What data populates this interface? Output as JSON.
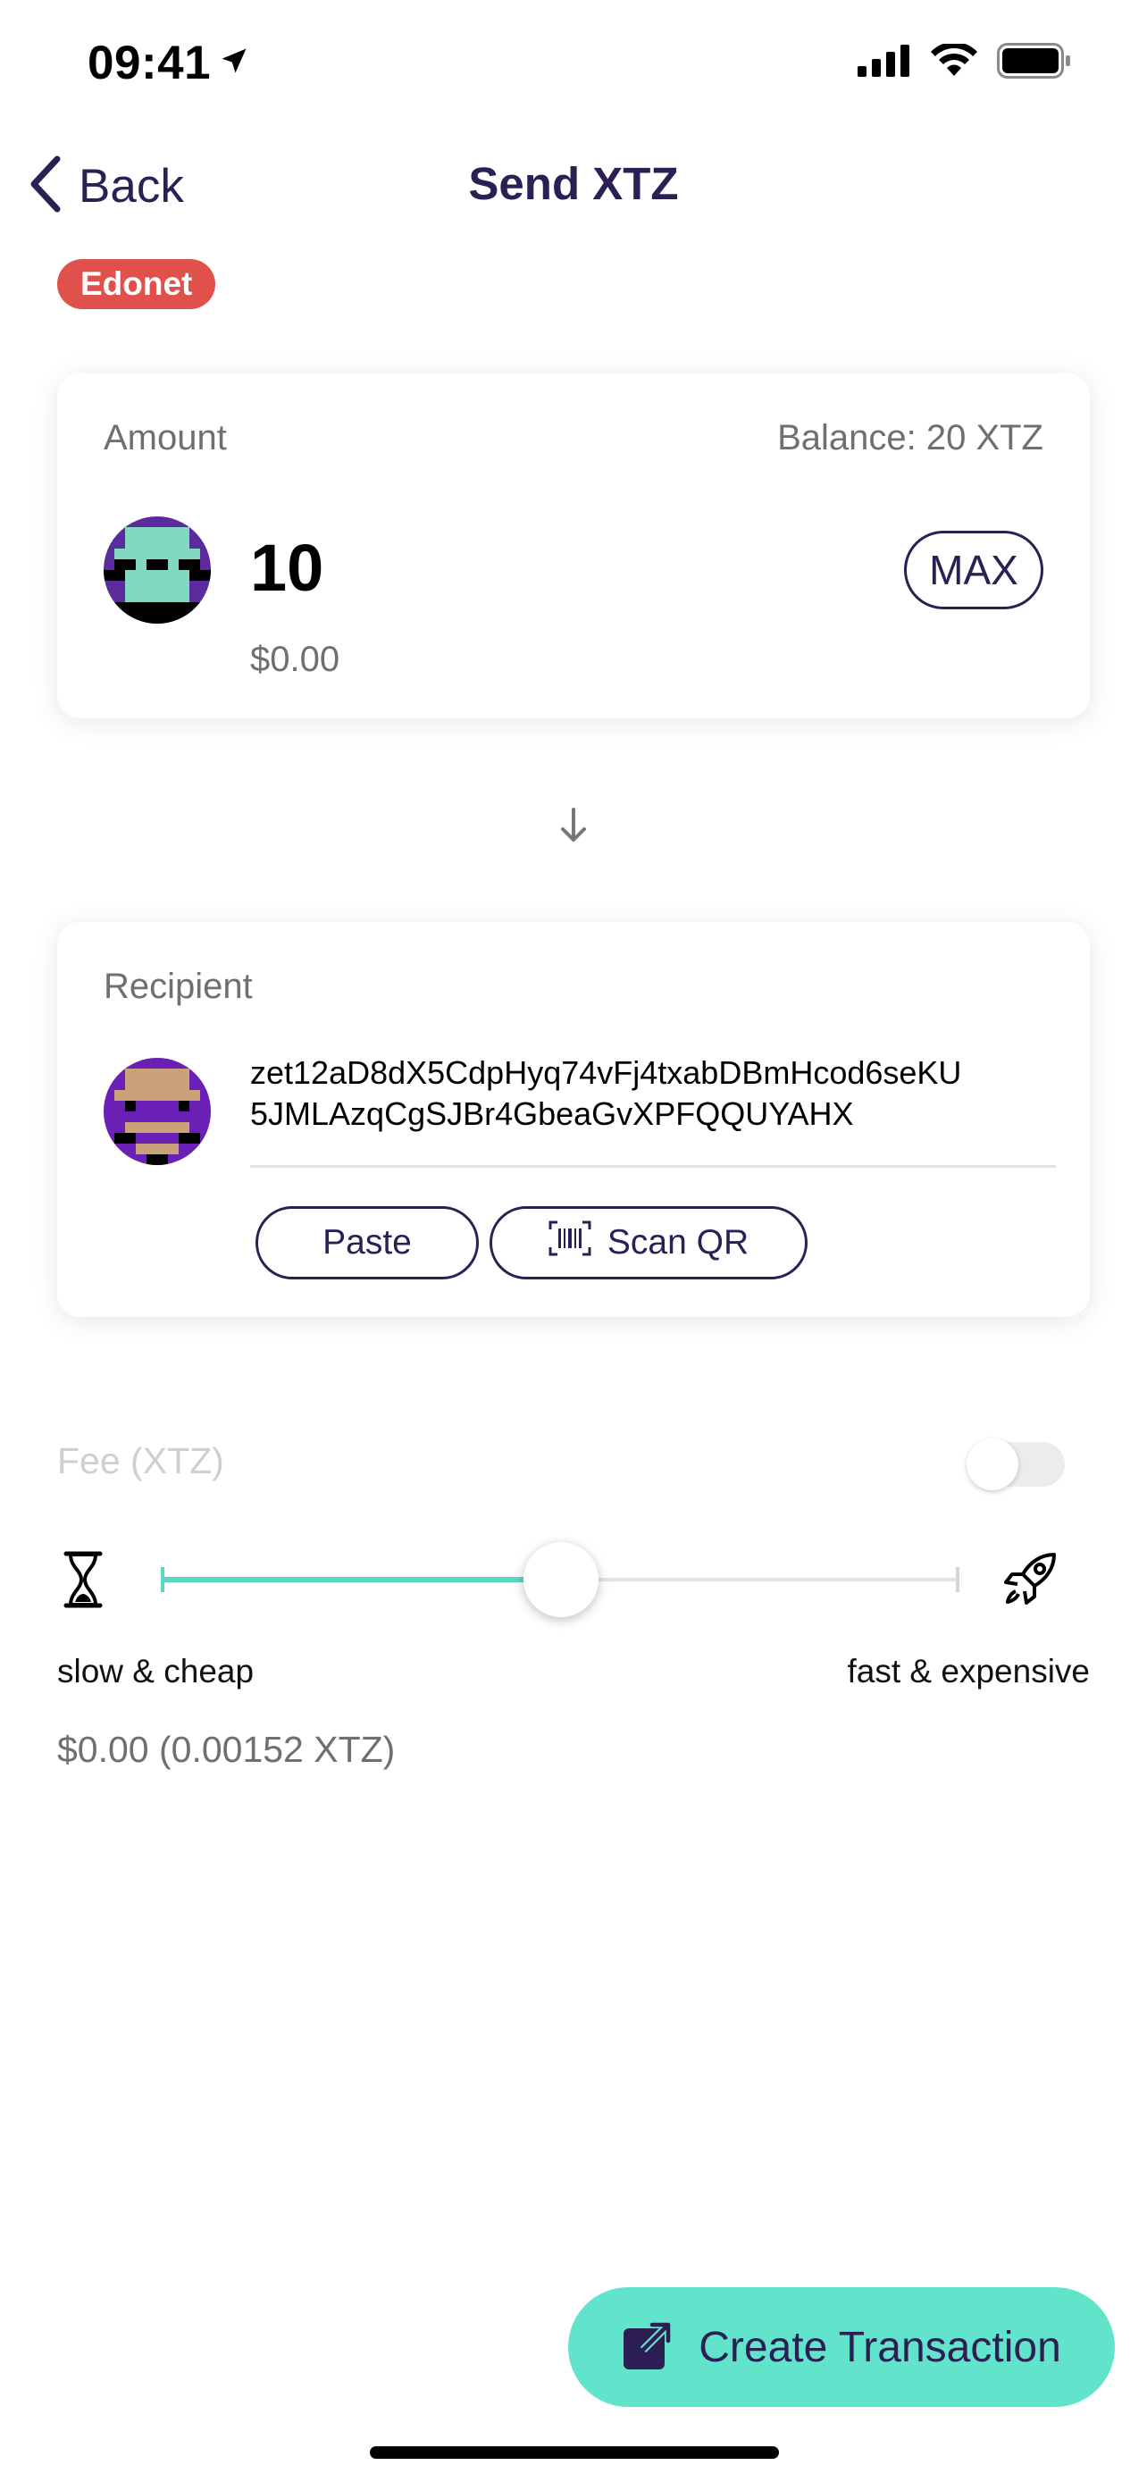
{
  "status_bar": {
    "time": "09:41"
  },
  "nav": {
    "back_label": "Back",
    "title": "Send XTZ"
  },
  "network_badge": "Edonet",
  "amount_card": {
    "label": "Amount",
    "balance": "Balance: 20 XTZ",
    "amount": "10",
    "fiat": "$0.00",
    "max_label": "MAX"
  },
  "recipient_card": {
    "label": "Recipient",
    "address_line1": "zet12aD8dX5CdpHyq74vFj4txabDBmHcod6seKU",
    "address_line2": "5JMLAzqCgSJBr4GbeaGvXPFQQUYAHX",
    "paste_label": "Paste",
    "scan_label": "Scan QR"
  },
  "fee": {
    "label": "Fee (XTZ)",
    "custom_toggle_on": false,
    "slider_level": 0.5,
    "slow_label": "slow & cheap",
    "fast_label": "fast & expensive",
    "value": "$0.00 (0.00152 XTZ)"
  },
  "cta": {
    "label": "Create Transaction"
  },
  "colors": {
    "accent": "#62e3cc",
    "primary": "#2b1f54",
    "badge": "#e0514c"
  }
}
